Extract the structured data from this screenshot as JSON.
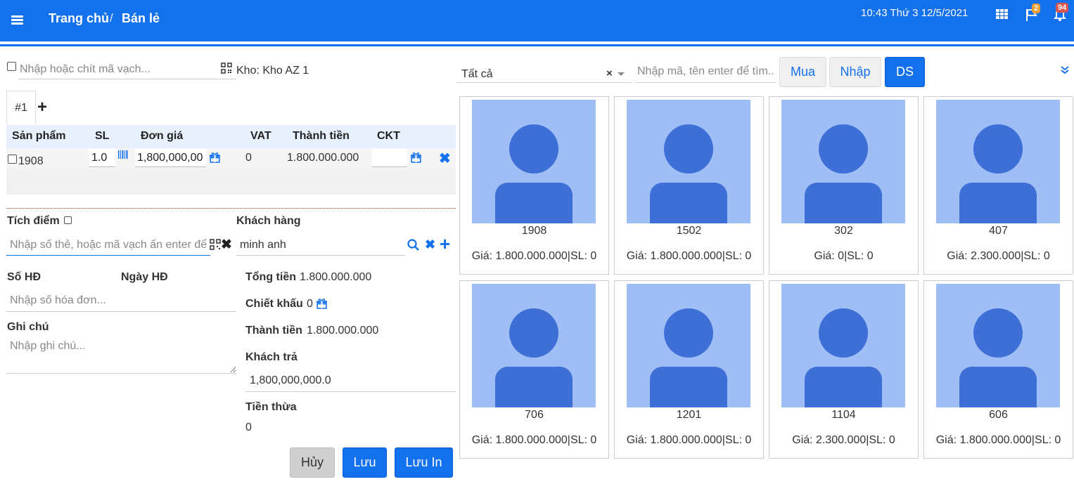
{
  "header": {
    "breadcrumb_home": "Trang chủ",
    "breadcrumb_sep": "/",
    "breadcrumb_current": "Bán lẻ",
    "datetime": "10:43  Thứ 3 12/5/2021",
    "flag_badge": "2",
    "bell_badge": "94"
  },
  "left": {
    "barcode_placeholder": "Nhập hoặc chít mã vạch...",
    "warehouse": "Kho: Kho AZ 1",
    "tab_label": "#1",
    "table_headers": [
      "Sản phẩm",
      "SL",
      "Đơn giá",
      "VAT",
      "Thành tiền",
      "CKT"
    ],
    "row": {
      "product": "1908",
      "qty": "1.0",
      "unit_price": "1,800,000,00",
      "vat": "0",
      "total": "1.800.000.000",
      "ckt": ""
    },
    "points_label": "Tích điểm",
    "card_placeholder": "Nhập số thẻ, hoặc mã vạch ấn enter để tìm",
    "customer_label": "Khách hàng",
    "customer_value": "minh anh",
    "invoice_no_label": "Số HĐ",
    "invoice_date_label": "Ngày HĐ",
    "invoice_placeholder": "Nhập số hóa đơn...",
    "note_label": "Ghi chú",
    "note_placeholder": "Nhập ghi chú...",
    "total_label": "Tổng tiền",
    "total_value": "1.800.000.000",
    "discount_label": "Chiết khấu",
    "discount_value": "0",
    "net_label": "Thành tiền",
    "net_value": "1.800.000.000",
    "paid_label": "Khách trả",
    "paid_value": "1,800,000,000.0",
    "change_label": "Tiền thừa",
    "change_value": "0",
    "btn_cancel": "Hủy",
    "btn_save": "Lưu",
    "btn_save_print": "Lưu In"
  },
  "right": {
    "category_selected": "Tất cả",
    "search_placeholder": "Nhập mã, tên enter để tìm...",
    "btn_buy": "Mua",
    "btn_import": "Nhập",
    "btn_list": "DS",
    "products": [
      {
        "name": "1908",
        "price": "Giá: 1.800.000.000|SL: 0"
      },
      {
        "name": "1502",
        "price": "Giá: 1.800.000.000|SL: 0"
      },
      {
        "name": "302",
        "price": "Giá: 0|SL: 0"
      },
      {
        "name": "407",
        "price": "Giá: 2.300.000|SL: 0"
      },
      {
        "name": "706",
        "price": "Giá: 1.800.000.000|SL: 0"
      },
      {
        "name": "1201",
        "price": "Giá: 1.800.000.000|SL: 0"
      },
      {
        "name": "1104",
        "price": "Giá: 2.300.000|SL: 0"
      },
      {
        "name": "606",
        "price": "Giá: 1.800.000.000|SL: 0"
      }
    ]
  },
  "colors": {
    "primary": "#1471ee",
    "avatar_bg": "#9ebef5",
    "avatar_fg": "#3d6fd6"
  }
}
